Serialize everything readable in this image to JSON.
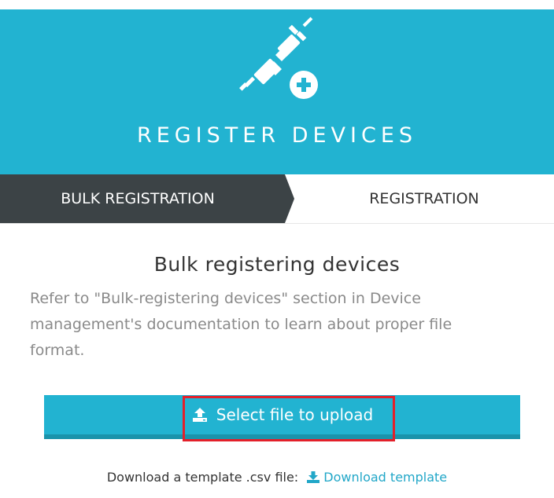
{
  "header": {
    "title": "REGISTER DEVICES",
    "icon": "plug-add-icon",
    "background_color": "#22b3d1"
  },
  "tabs": [
    {
      "label": "BULK REGISTRATION",
      "active": true
    },
    {
      "label": "REGISTRATION",
      "active": false
    }
  ],
  "main": {
    "section_title": "Bulk registering devices",
    "description": "Refer to \"Bulk-registering devices\" section in Device management's documentation to learn about proper file format.",
    "upload_button_label": "Select file to upload",
    "upload_icon": "upload-icon",
    "download_prompt": "Download a template .csv file:",
    "download_link_label": "Download template",
    "download_icon": "download-icon"
  },
  "colors": {
    "accent": "#22b3d1",
    "tab_active_bg": "#3c4346",
    "highlight": "#e3202a"
  }
}
